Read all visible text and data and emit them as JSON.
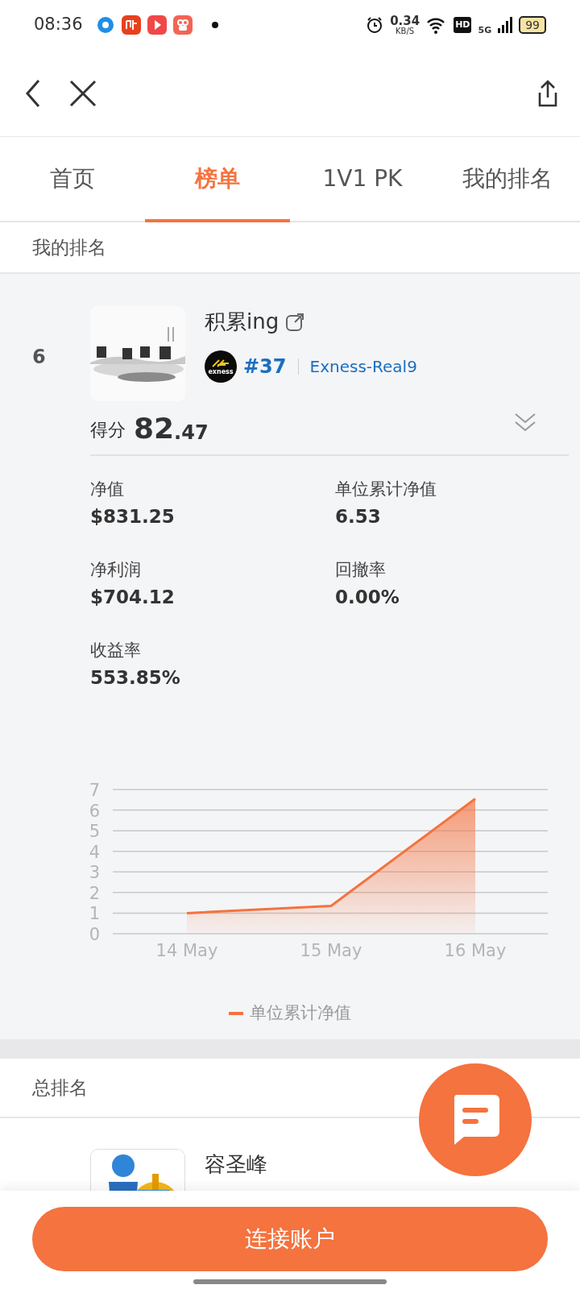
{
  "status_bar": {
    "time": "08:36",
    "speed_value": "0.34",
    "speed_unit": "KB/S",
    "hd": "HD",
    "network": "5G",
    "battery": "99"
  },
  "tabs": [
    {
      "label": "首页",
      "selected": false
    },
    {
      "label": "榜单",
      "selected": true
    },
    {
      "label": "1V1 PK",
      "selected": false
    },
    {
      "label": "我的排名",
      "selected": false
    }
  ],
  "my_ranking": {
    "title": "我的排名",
    "rank": "6",
    "name": "积累ing",
    "number": "#37",
    "server": "Exness-Real9",
    "broker_logo": "exness",
    "score_label": "得分",
    "score_int": "82",
    "score_dec": ".47",
    "stats": [
      {
        "label": "净值",
        "value": "$831.25"
      },
      {
        "label": "单位累计净值",
        "value": "6.53"
      },
      {
        "label": "净利润",
        "value": "$704.12"
      },
      {
        "label": "回撤率",
        "value": "0.00%"
      },
      {
        "label": "收益率",
        "value": "553.85%"
      }
    ],
    "chart_data": {
      "type": "area",
      "categories": [
        "14 May",
        "15 May",
        "16 May"
      ],
      "series": [
        {
          "name": "单位累计净值",
          "color": "#f4733f",
          "values": [
            1.0,
            1.35,
            6.55
          ]
        }
      ],
      "ylim": [
        0,
        7
      ],
      "grid": true,
      "yticks": [
        0,
        1,
        2,
        3,
        4,
        5,
        6,
        7
      ]
    }
  },
  "total_ranking": {
    "title": "总排名",
    "items": [
      {
        "name": "容圣峰"
      }
    ]
  },
  "connect_button": "连接账户"
}
